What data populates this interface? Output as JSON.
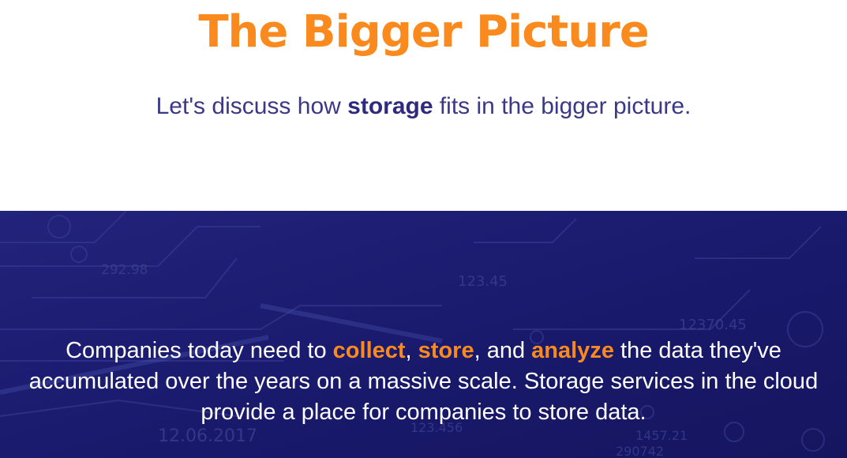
{
  "header": {
    "title": "The Bigger Picture",
    "subtitle": {
      "before": "Let's discuss how ",
      "emphasis": "storage",
      "after": " fits in the bigger picture."
    }
  },
  "band": {
    "background_color": "#1a1a6e",
    "decor_numbers": [
      "292.98",
      "123.45",
      "12370.45",
      "12.06.2017",
      "123.456",
      "1457.21",
      "290742"
    ],
    "text": {
      "part1": "Companies today need to ",
      "keyword1": "collect",
      "sep1": ", ",
      "keyword2": "store",
      "sep2": ", and ",
      "keyword3": "analyze",
      "part2": " the data they've accumulated over the years on a massive scale. Storage services in the cloud provide a place for companies to store data."
    }
  },
  "colors": {
    "accent_orange": "#fa8a1e",
    "navy_text": "#3b3886",
    "band_navy": "#1a1a6e"
  }
}
